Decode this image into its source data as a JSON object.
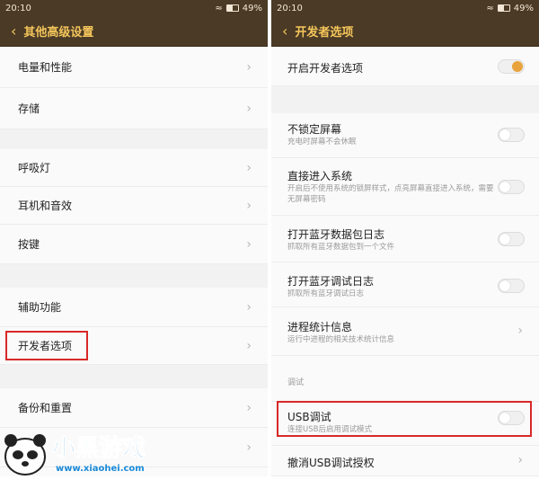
{
  "left": {
    "status": {
      "time": "20:10",
      "battery": "49%"
    },
    "title": "其他高级设置",
    "items": [
      {
        "label": "电量和性能"
      },
      {
        "label": "存储"
      },
      {
        "label": "呼吸灯"
      },
      {
        "label": "耳机和音效"
      },
      {
        "label": "按键"
      },
      {
        "label": "辅助功能"
      },
      {
        "label": "开发者选项"
      },
      {
        "label": "备份和重置"
      }
    ]
  },
  "right": {
    "status": {
      "time": "20:10",
      "battery": "49%"
    },
    "title": "开发者选项",
    "dev_toggle": {
      "label": "开启开发者选项",
      "on": true
    },
    "items": [
      {
        "label": "不锁定屏幕",
        "sub": "充电时屏幕不会休眠"
      },
      {
        "label": "直接进入系统",
        "sub": "开启后不使用系统的锁屏样式，点亮屏幕直接进入系统，需要无屏幕密码"
      },
      {
        "label": "打开蓝牙数据包日志",
        "sub": "抓取所有蓝牙数据包到一个文件"
      },
      {
        "label": "打开蓝牙调试日志",
        "sub": "抓取所有蓝牙调试日志"
      },
      {
        "label": "进程统计信息",
        "sub": "运行中进程的相关技术统计信息"
      }
    ],
    "section_label": "调试",
    "usb": {
      "label": "USB调试",
      "sub": "连接USB后启用调试模式"
    },
    "revoke": {
      "label": "撤消USB调试授权"
    }
  },
  "watermark": {
    "text": "小黑游戏",
    "url": "www.xiaohei.com"
  },
  "colors": {
    "header": "#4a3a26",
    "title": "#f5c65b",
    "accent": "#e8a33c",
    "highlight": "#d82828"
  }
}
